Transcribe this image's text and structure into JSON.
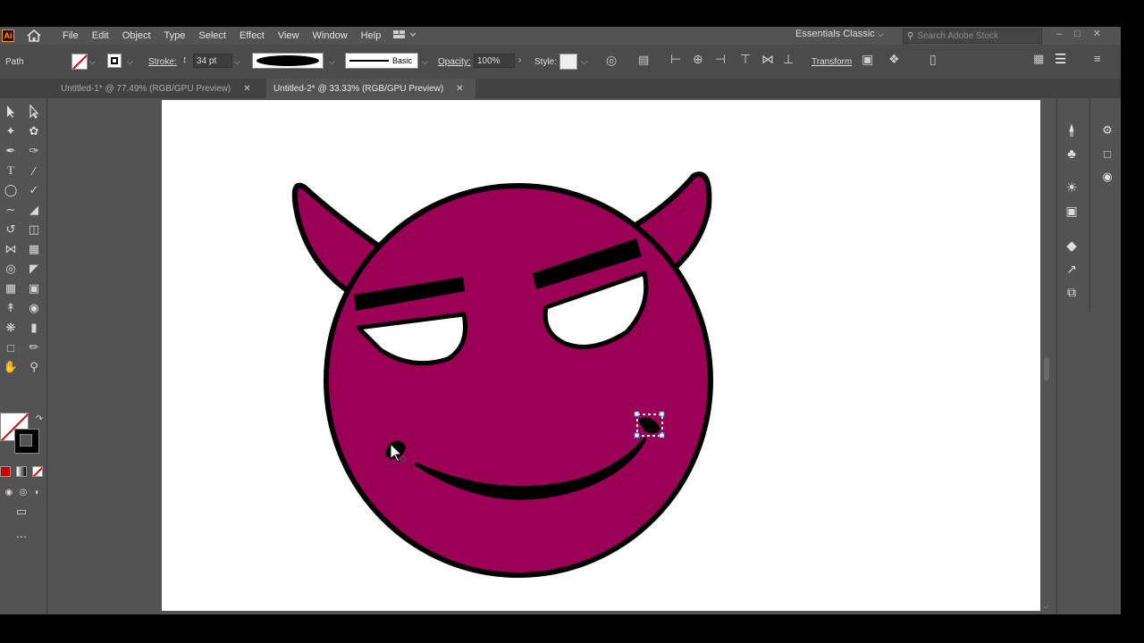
{
  "app": {
    "logo_text": "Ai",
    "menu": [
      "File",
      "Edit",
      "Object",
      "Type",
      "Select",
      "Effect",
      "View",
      "Window",
      "Help"
    ],
    "workspace": "Essentials Classic",
    "search_placeholder": "Search Adobe Stock"
  },
  "control_bar": {
    "selection_label": "Path",
    "stroke_label": "Stroke:",
    "stroke_value": "34 pt",
    "brush_label": "Basic",
    "opacity_label": "Opacity:",
    "opacity_value": "100%",
    "style_label": "Style:",
    "transform_label": "Transform"
  },
  "tabs": [
    {
      "label": "Untitled-1* @ 77.49% (RGB/GPU Preview)",
      "active": false
    },
    {
      "label": "Untitled-2* @ 33.33% (RGB/GPU Preview)",
      "active": true
    }
  ],
  "artwork": {
    "face_color": "#9b0056",
    "outline_color": "#000000",
    "eye_color": "#ffffff"
  },
  "colors": {
    "chrome_dark": "#4b4b4b",
    "chrome": "#535353",
    "tabbar": "#424242"
  }
}
